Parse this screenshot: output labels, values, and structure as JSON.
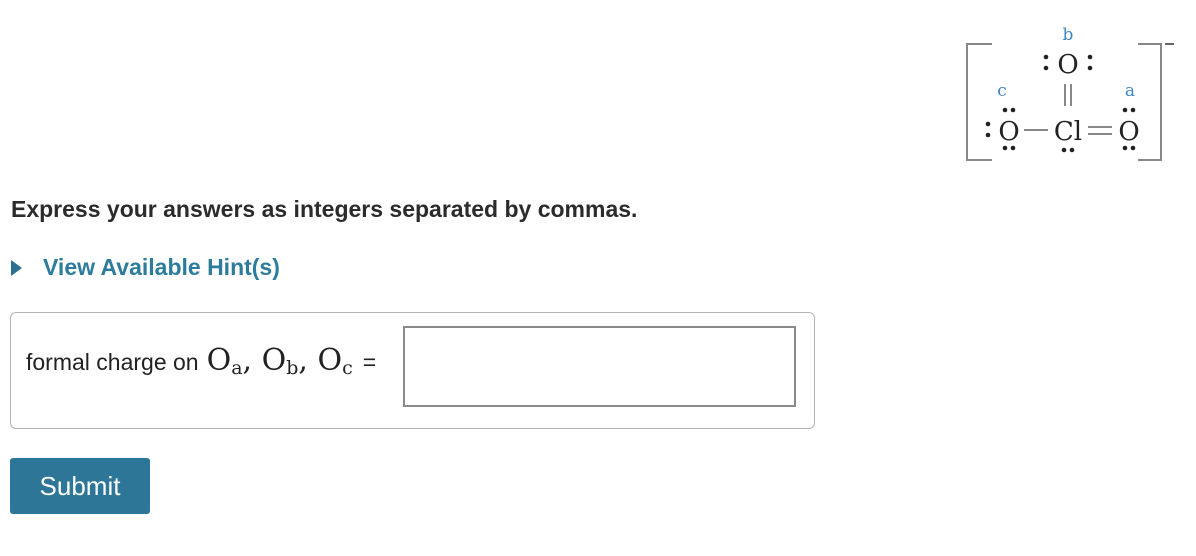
{
  "structure": {
    "atoms": {
      "o_b": "O",
      "o_c": "O",
      "cl": "Cl",
      "o_a": "O"
    },
    "labels": {
      "a": "a",
      "b": "b",
      "c": "c"
    },
    "charge": "−"
  },
  "instructions": "Express your answers as integers separated by commas.",
  "hint": {
    "label": "View Available Hint(s)"
  },
  "answer": {
    "prefix": "formal charge on",
    "symbols": [
      {
        "base": "O",
        "sub": "a"
      },
      {
        "base": "O",
        "sub": "b"
      },
      {
        "base": "O",
        "sub": "c"
      }
    ],
    "separator": ",",
    "equals": "=",
    "value": ""
  },
  "submit": {
    "label": "Submit"
  },
  "colors": {
    "accent": "#2d7697",
    "link": "#2d7c9c",
    "structure_label": "#3f86c2"
  }
}
